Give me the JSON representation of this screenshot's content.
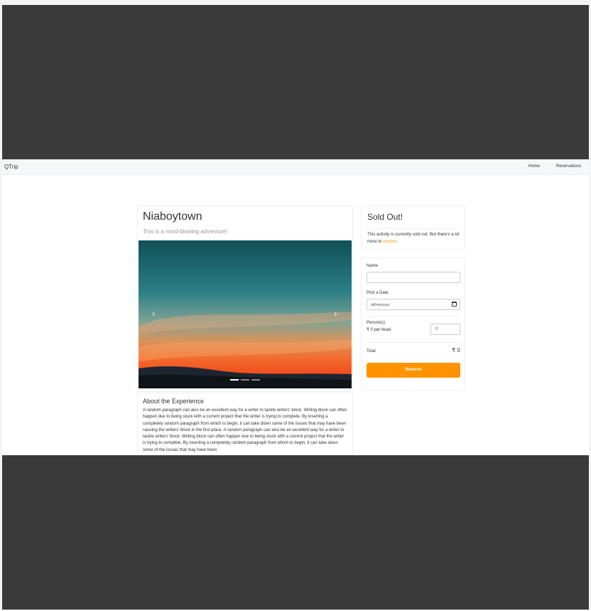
{
  "navbar": {
    "brand": "QTrip",
    "links": [
      "Home",
      "Reservations"
    ]
  },
  "adventure": {
    "title": "Niaboytown",
    "subtitle": "This is a mind-blowing adventure!",
    "carousel": {
      "slides": 3,
      "active_index": 0
    }
  },
  "about": {
    "title": "About the Experience",
    "text": "A random paragraph can also be an excellent way for a writer to tackle writers' block. Writing block can often happen due to being stuck with a current project that the writer is trying to complete. By inserting a completely random paragraph from which to begin, it can take down some of the issues that may have been causing the writers' block in the first place. A random paragraph can also be an excellent way for a writer to tackle writers' block. Writing block can often happen due to being stuck with a current project that the writer is trying to complete. By inserting a completely random paragraph from which to begin, it can take down some of the issues that may have been"
  },
  "sold_out": {
    "title": "Sold Out!",
    "text": "This activity is currently sold out. But there's a lot more to",
    "link": "explore"
  },
  "reservation": {
    "name_label": "Name",
    "name_value": "",
    "date_label": "Pick a Date",
    "date_placeholder": "dd/mm/yyyy",
    "persons_label": "Person(s)",
    "per_head": "₹ 0 per head",
    "persons_value": "0",
    "total_label": "Total",
    "total_amount": "₹ 0",
    "reserve_button": "Reserve"
  },
  "colors": {
    "accent": "#ff9200",
    "link": "#f29a1f",
    "frame": "#3a3a3a"
  }
}
